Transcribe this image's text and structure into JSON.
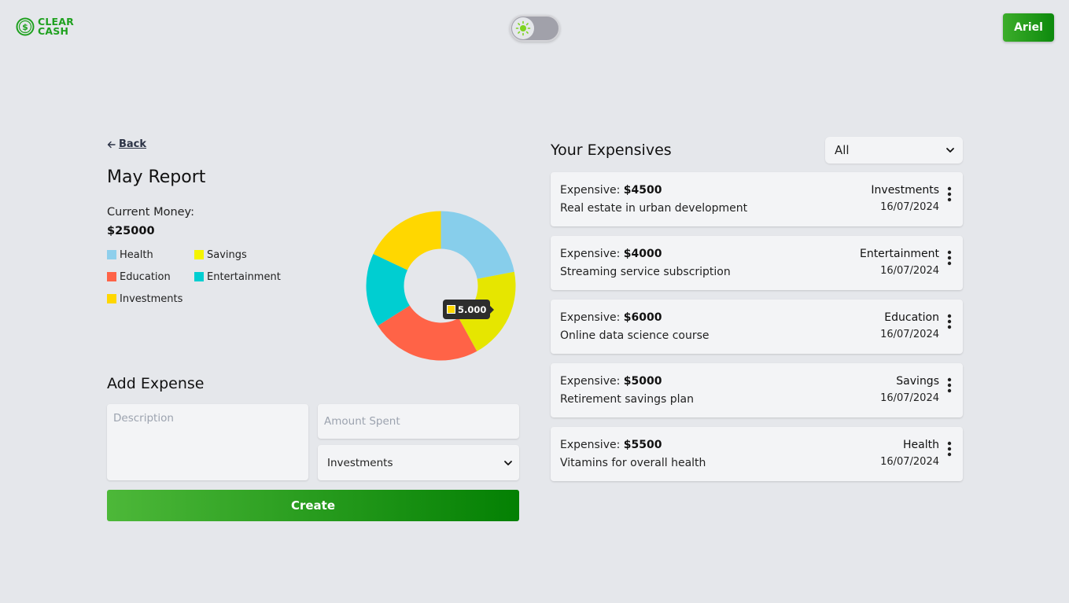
{
  "header": {
    "logo_line1": "CLEAR",
    "logo_line2": "CASH",
    "user_label": "Ariel"
  },
  "report": {
    "back_label": "Back",
    "title": "May Report",
    "current_money_label": "Current Money:",
    "current_money_value": "$25000"
  },
  "legend": [
    {
      "label": "Health",
      "color": "#8ecfec"
    },
    {
      "label": "Savings",
      "color": "#f4f400"
    },
    {
      "label": "Education",
      "color": "#ff6347"
    },
    {
      "label": "Entertainment",
      "color": "#00ced1"
    },
    {
      "label": "Investments",
      "color": "#ffd700"
    }
  ],
  "chart_data": {
    "type": "pie",
    "categories": [
      "Health",
      "Savings",
      "Education",
      "Entertainment",
      "Investments"
    ],
    "values": [
      5500,
      5000,
      6000,
      4000,
      4500
    ],
    "colors": [
      "#87ceeb",
      "#e6e600",
      "#ff6347",
      "#00ced1",
      "#ffd700"
    ],
    "tooltip": "5.000"
  },
  "add_expense": {
    "title": "Add Expense",
    "description_placeholder": "Description",
    "amount_placeholder": "Amount Spent",
    "category_selected": "Investments",
    "create_label": "Create"
  },
  "expenses": {
    "title": "Your Expensives",
    "filter_selected": "All",
    "amount_prefix": "Expensive: ",
    "items": [
      {
        "amount": "$4500",
        "description": "Real estate in urban development",
        "category": "Investments",
        "date": "16/07/2024"
      },
      {
        "amount": "$4000",
        "description": "Streaming service subscription",
        "category": "Entertainment",
        "date": "16/07/2024"
      },
      {
        "amount": "$6000",
        "description": "Online data science course",
        "category": "Education",
        "date": "16/07/2024"
      },
      {
        "amount": "$5000",
        "description": "Retirement savings plan",
        "category": "Savings",
        "date": "16/07/2024"
      },
      {
        "amount": "$5500",
        "description": "Vitamins for overall health",
        "category": "Health",
        "date": "16/07/2024"
      }
    ]
  }
}
